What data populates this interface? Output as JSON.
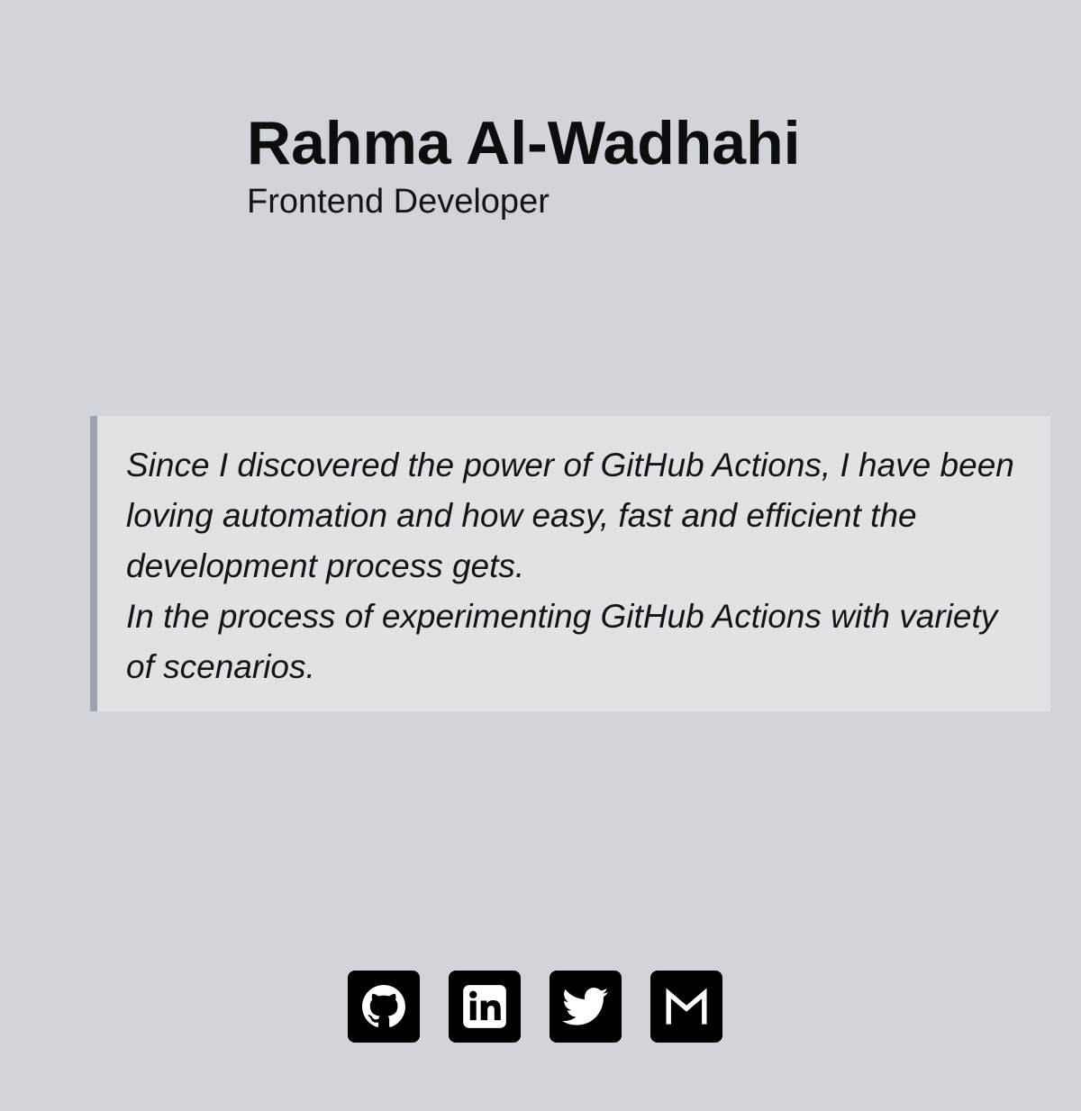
{
  "profile": {
    "name": "Rahma Al-Wadhahi",
    "title": "Frontend Developer"
  },
  "bio": {
    "line1": "Since I discovered the power of GitHub Actions, I have been loving automation and how easy, fast and efficient the development process gets.",
    "line2": "In the process of experimenting GitHub Actions with variety of scenarios."
  },
  "socials": [
    {
      "icon": "github-icon"
    },
    {
      "icon": "linkedin-icon"
    },
    {
      "icon": "twitter-icon"
    },
    {
      "icon": "gmail-icon"
    }
  ],
  "colors": {
    "background": "#d1d4d9",
    "quote_background": "#e0e2e6",
    "quote_border": "#9ca3af",
    "icon_background": "#000000",
    "text": "#0d0d0d"
  }
}
